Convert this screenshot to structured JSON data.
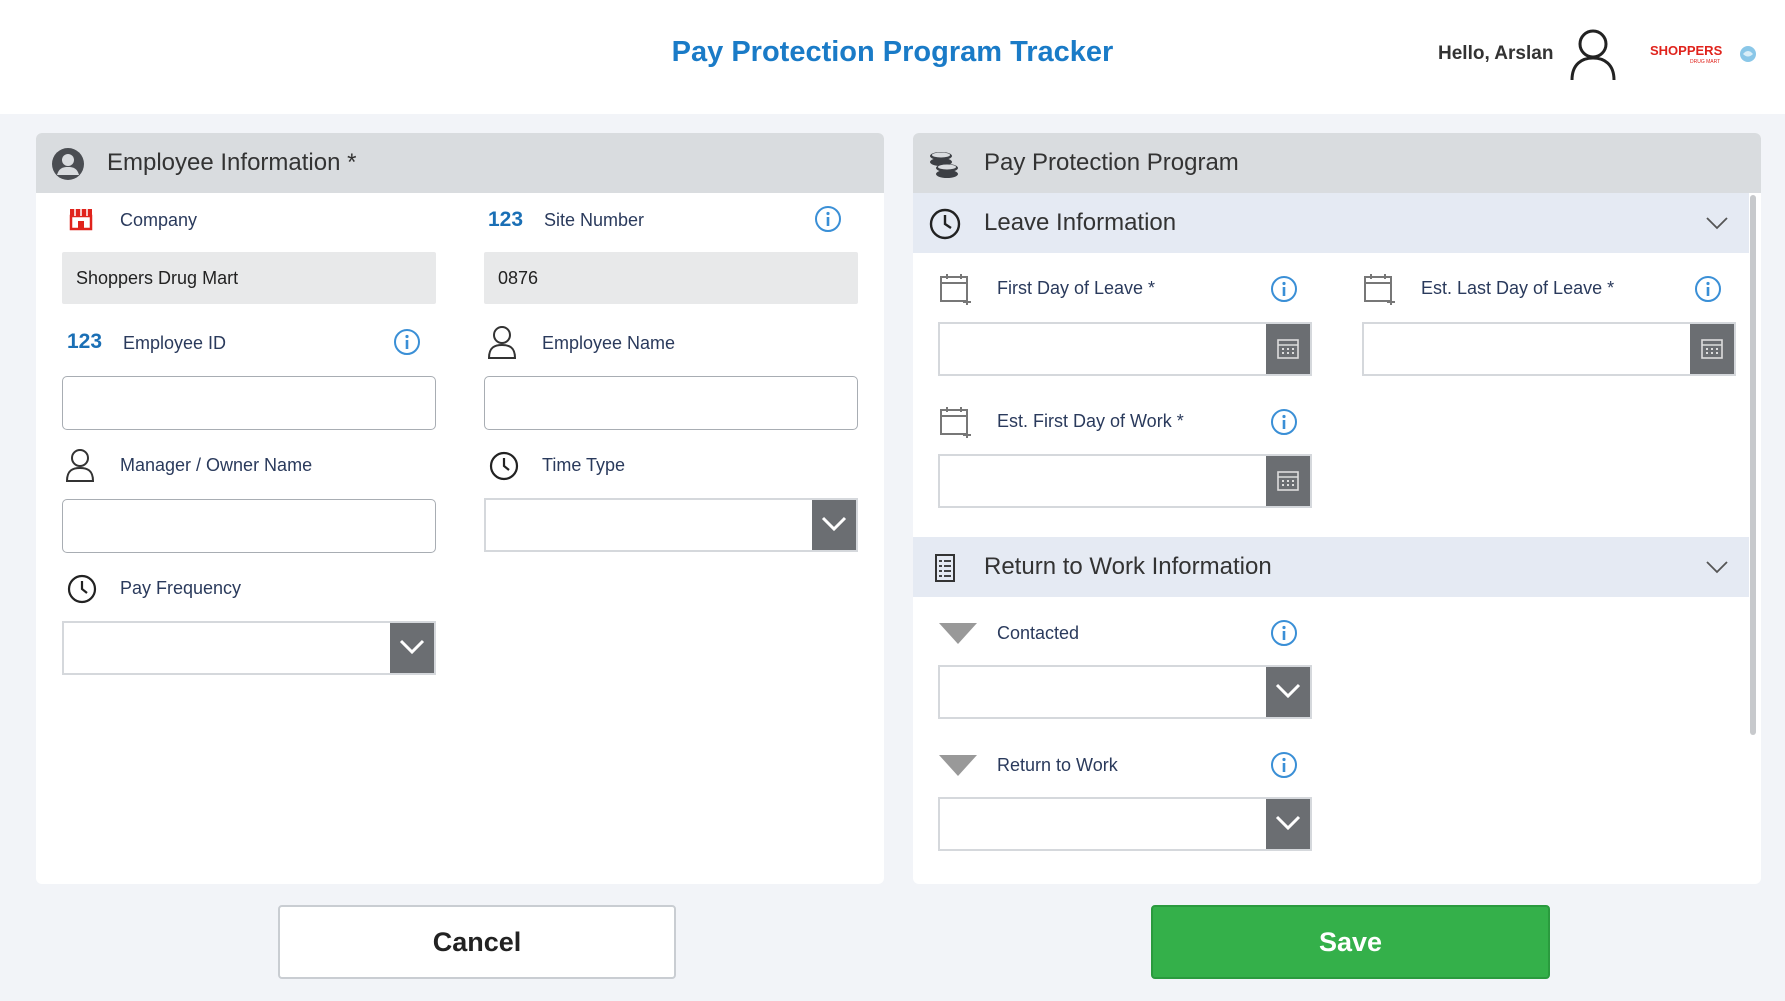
{
  "header": {
    "title": "Pay Protection Program Tracker",
    "greeting": "Hello, Arslan",
    "brand": "SHOPPERS",
    "brand_sub": "DRUG MART",
    "brand_color": "#e0231c",
    "title_color": "#1a7bc7"
  },
  "employee_panel": {
    "title": "Employee Information *",
    "company": {
      "label": "Company",
      "value": "Shoppers Drug Mart"
    },
    "site_number": {
      "label": "Site Number",
      "value": "0876",
      "badge": "123"
    },
    "employee_id": {
      "label": "Employee ID",
      "value": "",
      "badge": "123"
    },
    "employee_name": {
      "label": "Employee Name",
      "value": ""
    },
    "manager_name": {
      "label": "Manager / Owner Name",
      "value": ""
    },
    "time_type": {
      "label": "Time Type",
      "value": ""
    },
    "pay_frequency": {
      "label": "Pay Frequency",
      "value": ""
    }
  },
  "program_panel": {
    "title": "Pay Protection Program",
    "leave_section": {
      "title": "Leave Information",
      "first_day_leave": {
        "label": "First Day of Leave *",
        "value": ""
      },
      "est_last_day_leave": {
        "label": "Est. Last Day of Leave *",
        "value": ""
      },
      "est_first_day_work": {
        "label": "Est. First Day of Work *",
        "value": ""
      }
    },
    "rtw_section": {
      "title": "Return to Work Information",
      "contacted": {
        "label": "Contacted",
        "value": ""
      },
      "return_to_work": {
        "label": "Return to Work",
        "value": ""
      }
    }
  },
  "actions": {
    "cancel_label": "Cancel",
    "save_label": "Save",
    "save_color": "#34b04a"
  },
  "colors": {
    "accent_blue": "#1a7bc7",
    "info_blue": "#3a8fd6",
    "panel_header": "#d9dcdf",
    "section_bar": "#e5eaf3",
    "dropdown_button": "#6b6e72"
  }
}
